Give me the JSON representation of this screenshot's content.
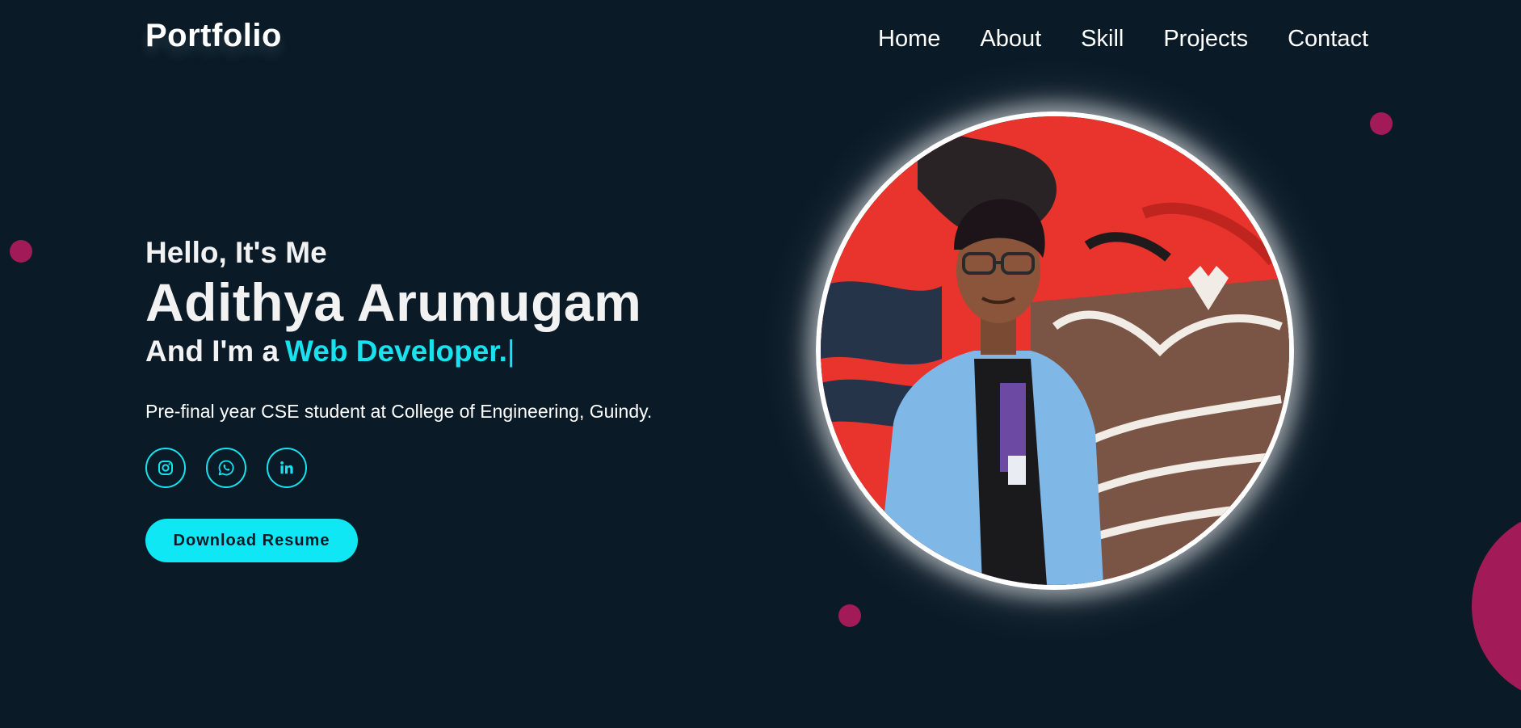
{
  "header": {
    "logo": "Portfolio",
    "nav": [
      "Home",
      "About",
      "Skill",
      "Projects",
      "Contact"
    ]
  },
  "hero": {
    "greeting": "Hello, It's Me",
    "name": "Adithya Arumugam",
    "role_prefix": "And I'm a",
    "role": "Web Developer.",
    "cursor": "|",
    "tagline": "Pre-final year CSE student at College of Engineering, Guindy.",
    "socials": [
      "instagram-icon",
      "whatsapp-icon",
      "linkedin-icon"
    ],
    "resume_button": "Download Resume"
  },
  "colors": {
    "background": "#0a1a27",
    "accent": "#17e3f0",
    "decor": "#a21b58"
  }
}
